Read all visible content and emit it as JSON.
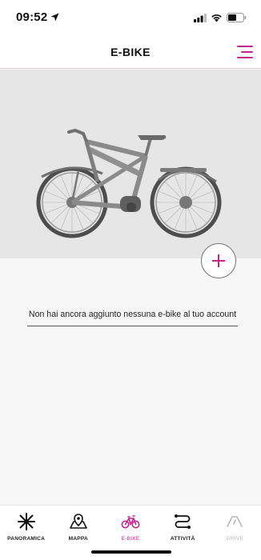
{
  "status_bar": {
    "time": "09:52"
  },
  "header": {
    "title": "E-BIKE"
  },
  "colors": {
    "accent": "#c3268c",
    "hero_background": "#e6e6e6"
  },
  "hero": {
    "image": "e-bike-photo"
  },
  "add_button": {
    "icon": "plus-icon"
  },
  "empty_state": {
    "message": "Non hai ancora aggiunto nessuna e-bike al tuo account"
  },
  "tabs": [
    {
      "label": "PANORAMICA",
      "icon": "snowflake-icon",
      "state": "normal"
    },
    {
      "label": "MAPPA",
      "icon": "map-icon",
      "state": "normal"
    },
    {
      "label": "E-BIKE",
      "icon": "bike-icon",
      "state": "active"
    },
    {
      "label": "ATTIVITÀ",
      "icon": "route-icon",
      "state": "normal"
    },
    {
      "label": "DRIVE",
      "icon": "gauge-icon",
      "state": "disabled"
    }
  ]
}
